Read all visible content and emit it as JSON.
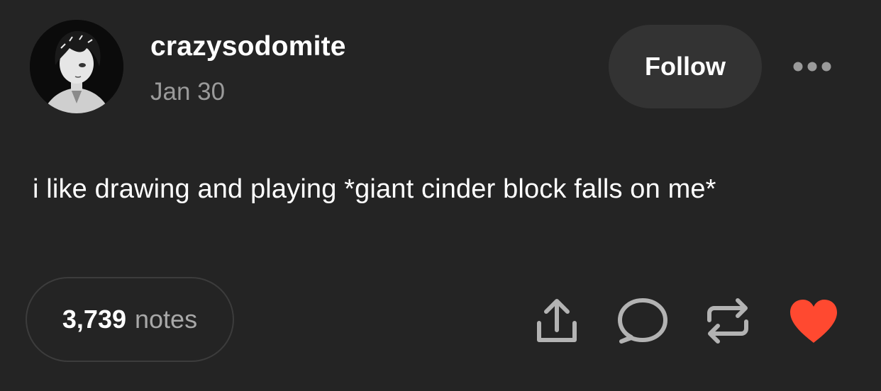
{
  "post": {
    "author": "crazysodomite",
    "date": "Jan 30",
    "body": "i like drawing and playing *giant cinder block falls on me*",
    "follow_label": "Follow",
    "notes_count": "3,739",
    "notes_label": "notes"
  },
  "icons": {
    "more": "more-options-icon",
    "share": "share-icon",
    "reply": "reply-bubble-icon",
    "reblog": "reblog-icon",
    "like": "heart-icon"
  },
  "colors": {
    "background": "#242424",
    "follow_button": "#333333",
    "secondary_text": "#9a9a9a",
    "icon": "#b3b3b3",
    "like": "#ff4930"
  }
}
